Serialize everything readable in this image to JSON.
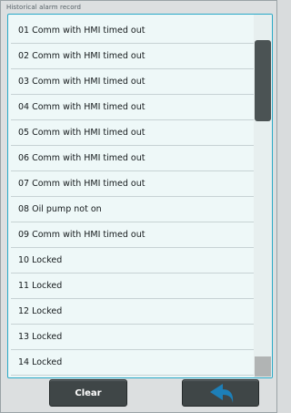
{
  "panel": {
    "title": "Historical alarm record"
  },
  "alarms": [
    "01 Comm with HMI timed out",
    "02 Comm with HMI timed out",
    "03 Comm with HMI timed out",
    "04 Comm with HMI timed out",
    "05 Comm with HMI timed out",
    "06 Comm with HMI timed out",
    "07 Comm with HMI timed out",
    "08 Oil pump not on",
    "09 Comm with HMI timed out",
    "10 Locked",
    "11 Locked",
    "12 Locked",
    "13 Locked",
    "14 Locked"
  ],
  "buttons": {
    "clear_label": "Clear",
    "back_icon": "back-arrow-icon"
  },
  "colors": {
    "accent_border": "#29a9c7",
    "back_arrow": "#1d7fb8",
    "button_bg": "#3f4647"
  }
}
